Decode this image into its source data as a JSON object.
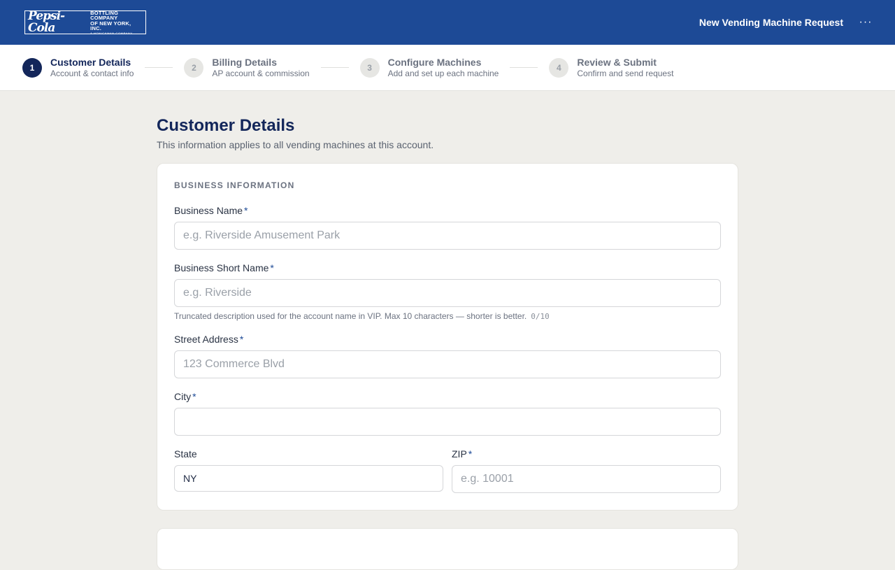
{
  "header": {
    "logo": {
      "script": "Pepsi-Cola",
      "line1": "BOTTLING COMPANY",
      "line2": "OF NEW YORK, INC.",
      "line3": "A HONICKMAN COMPANY"
    },
    "title": "New Vending Machine Request",
    "more_icon": "ellipsis-icon",
    "colors": {
      "bar": "#1d4a96"
    }
  },
  "stepper": {
    "steps": [
      {
        "num": "1",
        "title": "Customer Details",
        "subtitle": "Account & contact info",
        "active": true
      },
      {
        "num": "2",
        "title": "Billing Details",
        "subtitle": "AP account & commission",
        "active": false
      },
      {
        "num": "3",
        "title": "Configure Machines",
        "subtitle": "Add and set up each machine",
        "active": false
      },
      {
        "num": "4",
        "title": "Review & Submit",
        "subtitle": "Confirm and send request",
        "active": false
      }
    ]
  },
  "page": {
    "title": "Customer Details",
    "subtitle": "This information applies to all vending machines at this account."
  },
  "business": {
    "section_label": "BUSINESS INFORMATION",
    "name": {
      "label": "Business Name",
      "required": "*",
      "value": "",
      "placeholder": "e.g. Riverside Amusement Park"
    },
    "short_name": {
      "label": "Business Short Name",
      "required": "*",
      "value": "",
      "placeholder": "e.g. Riverside",
      "hint": "Truncated description used for the account name in VIP. Max 10 characters — shorter is better.",
      "counter": "0/10"
    },
    "street": {
      "label": "Street Address",
      "required": "*",
      "value": "",
      "placeholder": "123 Commerce Blvd"
    },
    "city": {
      "label": "City",
      "required": "*",
      "value": "",
      "placeholder": ""
    },
    "state": {
      "label": "State",
      "value": "NY"
    },
    "zip": {
      "label": "ZIP",
      "required": "*",
      "value": "",
      "placeholder": "e.g. 10001"
    }
  }
}
